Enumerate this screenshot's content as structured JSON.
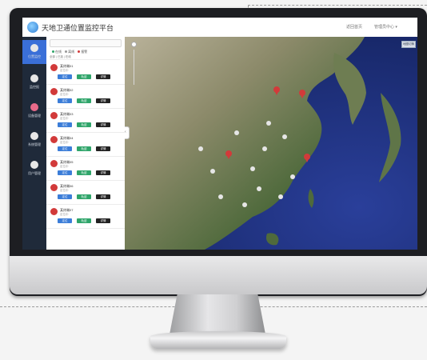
{
  "app": {
    "title": "天地卫通位置监控平台"
  },
  "topbar": {
    "link1": "返回首页",
    "link2": "管理员中心 ▾"
  },
  "rail": {
    "items": [
      {
        "label": "位置监控"
      },
      {
        "label": "监控报"
      },
      {
        "label": "设备管理"
      },
      {
        "label": "系统管理"
      },
      {
        "label": "用户管理"
      }
    ]
  },
  "panel": {
    "legend": [
      {
        "label": "在线",
        "color": "#2fa56a"
      },
      {
        "label": "离线",
        "color": "#999999"
      },
      {
        "label": "报警",
        "color": "#d23a3a"
      }
    ],
    "filter_text": "全部  | 已选  | 在线",
    "cards": [
      {
        "name": "某终端01",
        "sub": "定位中",
        "color": "#d23a3a"
      },
      {
        "name": "某终端02",
        "sub": "定位中",
        "color": "#d23a3a"
      },
      {
        "name": "某终端03",
        "sub": "定位中",
        "color": "#d23a3a"
      },
      {
        "name": "某终端04",
        "sub": "定位中",
        "color": "#d23a3a"
      },
      {
        "name": "某终端05",
        "sub": "定位中",
        "color": "#d23a3a"
      },
      {
        "name": "某终端06",
        "sub": "定位中",
        "color": "#d23a3a"
      },
      {
        "name": "某终端07",
        "sub": "定位中",
        "color": "#d23a3a"
      }
    ],
    "btn_labels": [
      "定位",
      "轨迹",
      "详情"
    ]
  },
  "map": {
    "button": "地图切换"
  },
  "colors": {
    "accent": "#3a6fd8",
    "rail": "#1f2a3a",
    "alert": "#d23a3a"
  }
}
